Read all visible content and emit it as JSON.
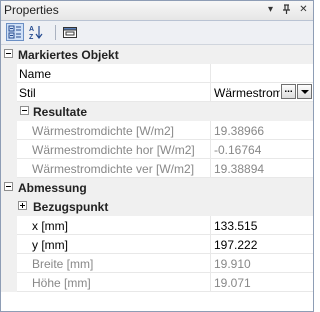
{
  "window": {
    "title": "Properties",
    "menu_icon": "▾",
    "pin_icon": "ᛘ",
    "close_icon": "✕"
  },
  "toolbar": {
    "categorized_tooltip": "",
    "alphabetical_tooltip": "",
    "pages_tooltip": ""
  },
  "categories": {
    "markiertes_objekt": "Markiertes Objekt",
    "resultate": "Resultate",
    "abmessung": "Abmessung",
    "bezugspunkt": "Bezugspunkt"
  },
  "properties": {
    "name": {
      "label": "Name",
      "value": ""
    },
    "stil": {
      "label": "Stil",
      "value": "Wärmestrom",
      "dots": "..."
    },
    "wsd": {
      "label": "Wärmestromdichte  [W/m2]",
      "value": "19.38966"
    },
    "wsd_hor": {
      "label": "Wärmestromdichte  hor [W/m2]",
      "value": "-0.16764"
    },
    "wsd_ver": {
      "label": "Wärmestromdichte  ver [W/m2]",
      "value": "19.38894"
    },
    "x": {
      "label": "x [mm]",
      "value": "133.515"
    },
    "y": {
      "label": "y [mm]",
      "value": "197.222"
    },
    "breite": {
      "label": "Breite [mm]",
      "value": "19.910"
    },
    "hoehe": {
      "label": "Höhe [mm]",
      "value": "19.071"
    }
  }
}
